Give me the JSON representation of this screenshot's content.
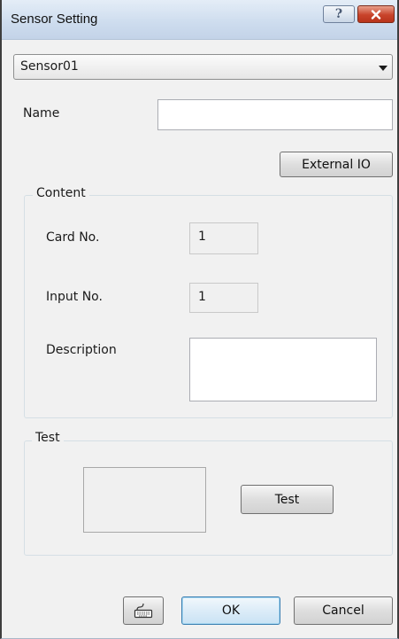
{
  "window": {
    "title": "Sensor Setting",
    "help_glyph": "?"
  },
  "sensor_select": {
    "selected": "Sensor01"
  },
  "name": {
    "label": "Name",
    "value": ""
  },
  "external_io_button": "External IO",
  "content": {
    "title": "Content",
    "card_no_label": "Card No.",
    "card_no_value": "1",
    "input_no_label": "Input No.",
    "input_no_value": "1",
    "description_label": "Description",
    "description_value": ""
  },
  "test": {
    "title": "Test",
    "button_label": "Test"
  },
  "footer": {
    "ok_label": "OK",
    "cancel_label": "Cancel"
  },
  "icons": {
    "help": "question-icon",
    "close": "close-icon",
    "keyboard": "keyboard-icon",
    "dropdown": "chevron-down-icon"
  }
}
